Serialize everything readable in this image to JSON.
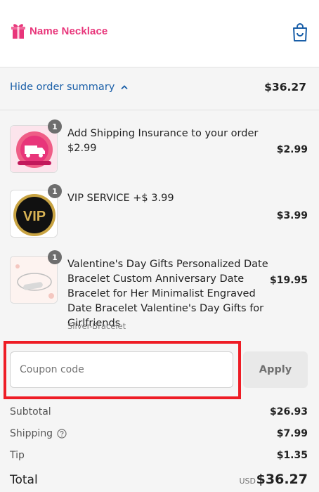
{
  "brand": {
    "name": "Name Necklace",
    "color": "#e8357a"
  },
  "summary_toggle": {
    "label": "Hide order summary",
    "total": "$36.27"
  },
  "items": [
    {
      "qty": "1",
      "title": "Add Shipping Insurance to your order $2.99",
      "variant": "",
      "price": "$2.99"
    },
    {
      "qty": "1",
      "title": "VIP SERVICE +$ 3.99",
      "variant": "",
      "price": "$3.99"
    },
    {
      "qty": "1",
      "title": "Valentine's Day Gifts Personalized Date Bracelet Custom Anniversary Date Bracelet for Her Minimalist Engraved Date Bracelet Valentine's Day Gifts for Girlfriends",
      "variant": "Silver-Bracelet",
      "price": "$19.95"
    }
  ],
  "coupon": {
    "placeholder": "Coupon code",
    "value": "",
    "apply_label": "Apply"
  },
  "totals": {
    "subtotal_label": "Subtotal",
    "subtotal": "$26.93",
    "shipping_label": "Shipping",
    "shipping": "$7.99",
    "tip_label": "Tip",
    "tip": "$1.35",
    "total_label": "Total",
    "currency": "USD",
    "total": "$36.27"
  },
  "colors": {
    "link": "#1a5fa8",
    "highlight": "#ee1c25",
    "panel": "#f5f5f5"
  }
}
